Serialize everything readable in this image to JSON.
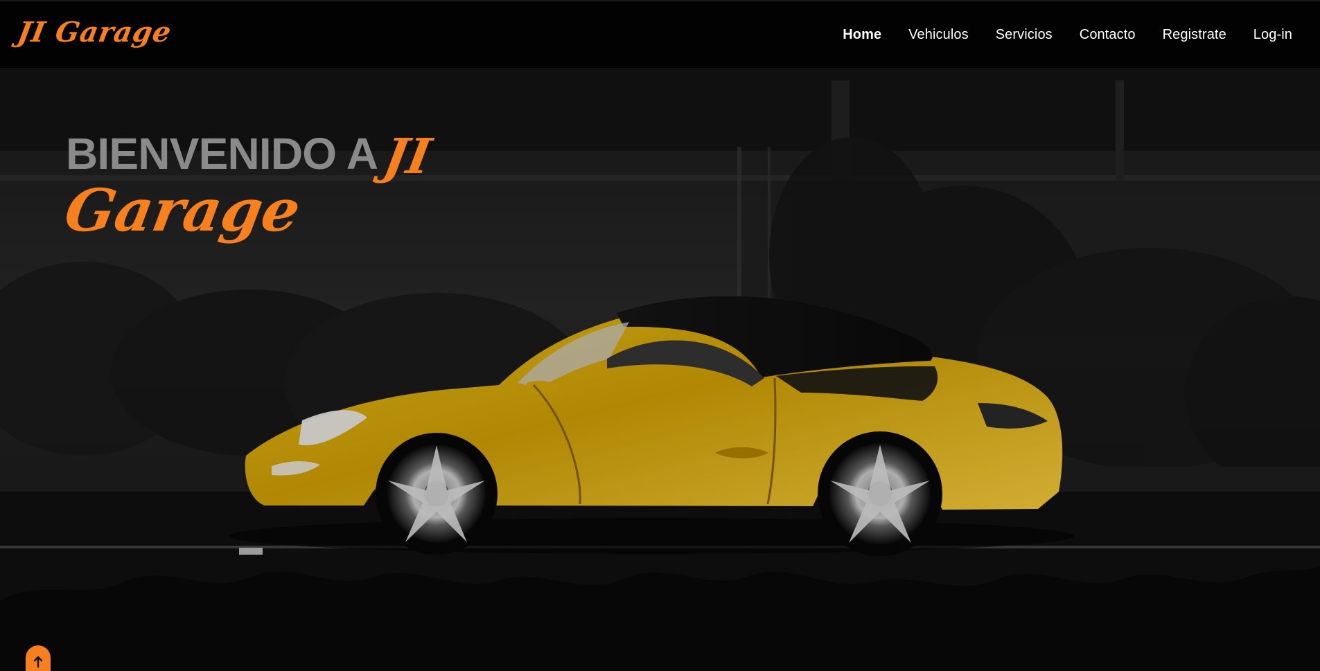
{
  "brand": {
    "logo_text": "JI Garage"
  },
  "nav": {
    "items": [
      {
        "label": "Home"
      },
      {
        "label": "Vehiculos"
      },
      {
        "label": "Servicios"
      },
      {
        "label": "Contacto"
      },
      {
        "label": "Registrate"
      },
      {
        "label": "Log-in"
      }
    ]
  },
  "hero": {
    "title_main": "BIENVENIDO A",
    "title_script_1": "JI",
    "title_script_2": "Garage"
  },
  "icons": {
    "scroll_top": "arrow-up-icon"
  },
  "colors": {
    "accent": "#f7801e",
    "navbar": "#020202",
    "car": "#e0b20b"
  }
}
